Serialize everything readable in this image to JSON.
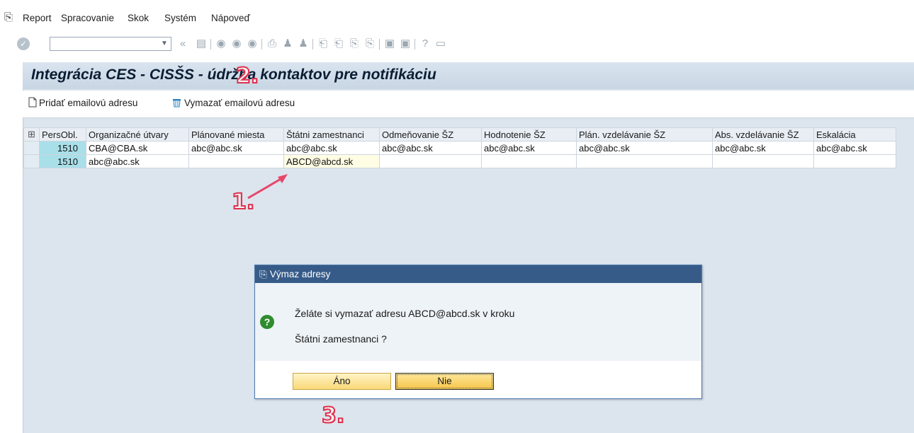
{
  "menu": {
    "items": [
      {
        "label": "Report"
      },
      {
        "label": "Spracovanie"
      },
      {
        "label": "Skok"
      },
      {
        "label": "Systém"
      },
      {
        "label": "Nápoveď"
      }
    ]
  },
  "toolbar": {
    "command_value": ""
  },
  "page": {
    "title": "Integrácia CES - CISŠS - údržba kontaktov pre notifikáciu"
  },
  "app_toolbar": {
    "add_label": "Pridať emailovú adresu",
    "delete_label": "Vymazať emailovú adresu"
  },
  "grid": {
    "columns": [
      "PersObl.",
      "Organizačné útvary",
      "Plánované miesta",
      "Štátni zamestnanci",
      "Odmeňovanie ŠZ",
      "Hodnotenie ŠZ",
      "Plán. vzdelávanie ŠZ",
      "Abs. vzdelávanie ŠZ",
      "Eskalácia"
    ],
    "rows": [
      [
        "1510",
        "CBA@CBA.sk",
        "abc@abc.sk",
        "abc@abc.sk",
        "abc@abc.sk",
        "abc@abc.sk",
        "abc@abc.sk",
        "abc@abc.sk",
        "abc@abc.sk"
      ],
      [
        "1510",
        "abc@abc.sk",
        "",
        "ABCD@abcd.sk",
        "",
        "",
        "",
        "",
        ""
      ]
    ]
  },
  "dialog": {
    "title": "Výmaz adresy",
    "line1": "Želáte si vymazať adresu ABCD@abcd.sk v kroku",
    "line2": "Štátni zamestnanci ?",
    "yes_label": "Áno",
    "no_label": "Nie"
  },
  "annotations": [
    "1.",
    "2.",
    "3."
  ],
  "colors": {
    "dialog_title_bg": "#375b88",
    "key_cell_bg": "#a9dfe9",
    "button_bg": "#f9d977",
    "annotation": "#e0304e"
  }
}
